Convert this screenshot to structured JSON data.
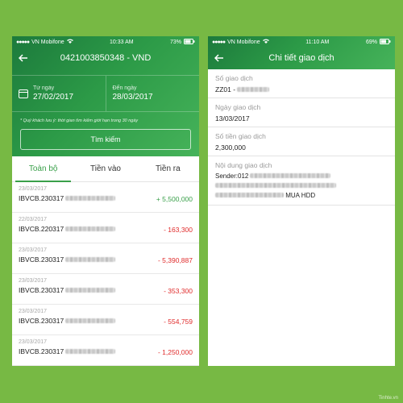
{
  "status_left": {
    "carrier": "VN Mobifone",
    "time": "10:33 AM",
    "battery": "73%"
  },
  "status_right": {
    "carrier": "VN Mobifone",
    "time": "11:10 AM",
    "battery": "69%"
  },
  "statement": {
    "title": "0421003850348 - VND",
    "from_label": "Từ ngày",
    "from_value": "27/02/2017",
    "to_label": "Đến ngày",
    "to_value": "28/03/2017",
    "note": "* Quý khách lưu ý: thời gian tìm kiếm giới hạn trong 30 ngày",
    "search_label": "Tìm kiếm",
    "tabs": [
      {
        "label": "Toàn bộ",
        "active": true
      },
      {
        "label": "Tiền vào",
        "active": false
      },
      {
        "label": "Tiền ra",
        "active": false
      }
    ],
    "transactions": [
      {
        "date": "23/03/2017",
        "desc": "IBVCB.230317",
        "amount": "+ 5,500,000",
        "type": "positive"
      },
      {
        "date": "22/03/2017",
        "desc": "IBVCB.220317",
        "amount": "- 163,300",
        "type": "negative"
      },
      {
        "date": "23/03/2017",
        "desc": "IBVCB.230317",
        "amount": "- 5,390,887",
        "type": "negative"
      },
      {
        "date": "23/03/2017",
        "desc": "IBVCB.230317",
        "amount": "- 353,300",
        "type": "negative"
      },
      {
        "date": "23/03/2017",
        "desc": "IBVCB.230317",
        "amount": "- 554,759",
        "type": "negative"
      },
      {
        "date": "23/03/2017",
        "desc": "IBVCB.230317",
        "amount": "- 1,250,000",
        "type": "negative"
      }
    ]
  },
  "detail": {
    "title": "Chi tiết giao dịch",
    "txn_no_label": "Số giao dịch",
    "txn_no_value": "ZZ01 -",
    "date_label": "Ngày giao dịch",
    "date_value": "13/03/2017",
    "amount_label": "Số tiền giao dịch",
    "amount_value": "2,300,000",
    "content_label": "Nội dung giao dịch",
    "content_prefix": "Sender:012",
    "content_suffix": "MUA HDD"
  },
  "watermark": "Tinhte.vn",
  "colors": {
    "background": "#77b944",
    "brand_green": "#2c9a47",
    "positive": "#3aa04a",
    "negative": "#e02b2b"
  }
}
